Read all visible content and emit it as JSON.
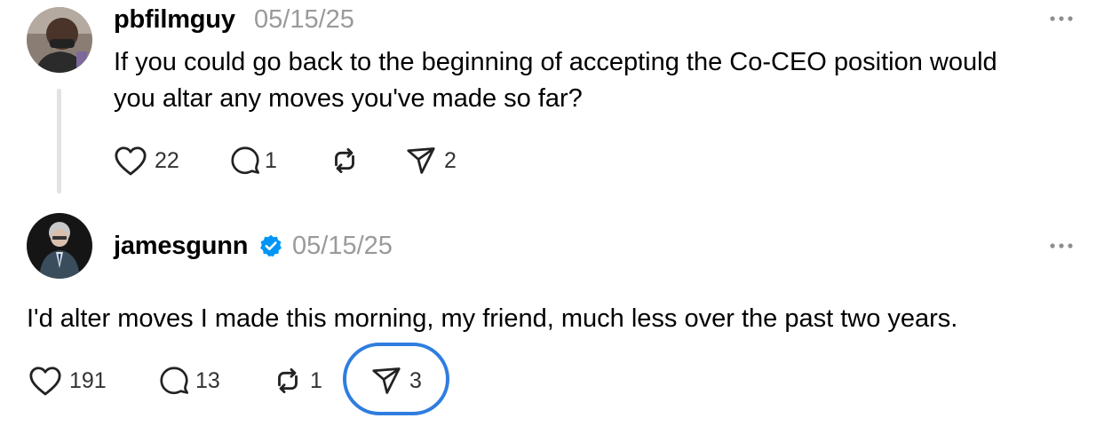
{
  "post": {
    "username": "pbfilmguy",
    "timestamp": "05/15/25",
    "text_line1": "If you could go back to the beginning of accepting the Co-CEO position would",
    "text_line2": "you altar any moves you've made so far?",
    "actions": {
      "likes": "22",
      "replies": "1",
      "reposts": "",
      "shares": "2"
    }
  },
  "reply": {
    "username": "jamesgunn",
    "verified": true,
    "timestamp": "05/15/25",
    "text": "I'd alter moves I made this morning, my friend, much less over the past two years.",
    "actions": {
      "likes": "191",
      "replies": "13",
      "reposts": "1",
      "shares": "3"
    }
  },
  "colors": {
    "verified_badge": "#0095f6",
    "highlight_ring": "#2f7de0",
    "timestamp": "#9a9a9a",
    "thread_line": "#e3e3e3"
  },
  "icons": [
    "heart-icon",
    "comment-icon",
    "repost-icon",
    "share-icon",
    "more-icon",
    "verified-icon"
  ]
}
